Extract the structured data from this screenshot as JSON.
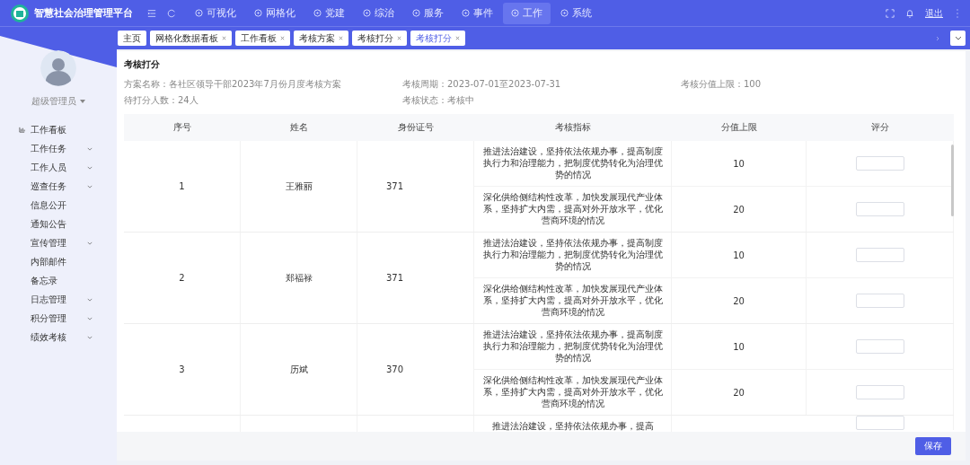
{
  "app": {
    "title": "智慧社会治理管理平台"
  },
  "nav": [
    {
      "label": "可视化",
      "selected": false
    },
    {
      "label": "网格化",
      "selected": false
    },
    {
      "label": "党建",
      "selected": false
    },
    {
      "label": "综治",
      "selected": false
    },
    {
      "label": "服务",
      "selected": false
    },
    {
      "label": "事件",
      "selected": false
    },
    {
      "label": "工作",
      "selected": true
    },
    {
      "label": "系统",
      "selected": false
    }
  ],
  "header_actions": {
    "logout": "退出"
  },
  "tabs": [
    {
      "label": "主页",
      "closable": false,
      "selected": false
    },
    {
      "label": "网格化数据看板",
      "closable": true,
      "selected": false
    },
    {
      "label": "工作看板",
      "closable": true,
      "selected": false
    },
    {
      "label": "考核方案",
      "closable": true,
      "selected": false
    },
    {
      "label": "考核打分",
      "closable": true,
      "selected": false
    },
    {
      "label": "考核打分",
      "closable": true,
      "selected": true
    }
  ],
  "sidebar": {
    "user": "超级管理员",
    "items": [
      {
        "label": "工作看板",
        "expandable": false,
        "icon": true
      },
      {
        "label": "工作任务",
        "expandable": true,
        "icon": false
      },
      {
        "label": "工作人员",
        "expandable": true,
        "icon": false
      },
      {
        "label": "巡查任务",
        "expandable": true,
        "icon": false
      },
      {
        "label": "信息公开",
        "expandable": false,
        "icon": false
      },
      {
        "label": "通知公告",
        "expandable": false,
        "icon": false
      },
      {
        "label": "宣传管理",
        "expandable": true,
        "icon": false
      },
      {
        "label": "内部邮件",
        "expandable": false,
        "icon": false
      },
      {
        "label": "备忘录",
        "expandable": false,
        "icon": false
      },
      {
        "label": "日志管理",
        "expandable": true,
        "icon": false
      },
      {
        "label": "积分管理",
        "expandable": true,
        "icon": false
      },
      {
        "label": "绩效考核",
        "expandable": true,
        "icon": false
      }
    ]
  },
  "panel": {
    "title": "考核打分",
    "info": [
      {
        "label": "方案名称：",
        "value": "各社区领导干部2023年7月份月度考核方案"
      },
      {
        "label": "考核周期：",
        "value": "2023-07-01至2023-07-31"
      },
      {
        "label": "考核分值上限：",
        "value": "100"
      },
      {
        "label": "待打分人数：",
        "value": "24人"
      },
      {
        "label": "考核状态：",
        "value": "考核中"
      }
    ]
  },
  "table": {
    "columns": [
      "序号",
      "姓名",
      "身份证号",
      "考核指标",
      "分值上限",
      "评分"
    ],
    "rows": [
      {
        "index": "1",
        "name": "王雅丽",
        "id": "371",
        "criteria": [
          {
            "text": "推进法治建设，坚持依法依规办事，提高制度执行力和治理能力，把制度优势转化为治理优势的情况",
            "max": "10"
          },
          {
            "text": "深化供给侧结构性改革，加快发展现代产业体系，坚持扩大内需，提高对外开放水平，优化营商环境的情况",
            "max": "20"
          }
        ]
      },
      {
        "index": "2",
        "name": "郑福禄",
        "id": "371",
        "criteria": [
          {
            "text": "推进法治建设，坚持依法依规办事，提高制度执行力和治理能力，把制度优势转化为治理优势的情况",
            "max": "10"
          },
          {
            "text": "深化供给侧结构性改革，加快发展现代产业体系，坚持扩大内需，提高对外开放水平，优化营商环境的情况",
            "max": "20"
          }
        ]
      },
      {
        "index": "3",
        "name": "历斌",
        "id": "370",
        "criteria": [
          {
            "text": "推进法治建设，坚持依法依规办事，提高制度执行力和治理能力，把制度优势转化为治理优势的情况",
            "max": "10"
          },
          {
            "text": "深化供给侧结构性改革，加快发展现代产业体系，坚持扩大内需，提高对外开放水平，优化营商环境的情况",
            "max": "20"
          }
        ]
      },
      {
        "criteria": [
          {
            "text": "推进法治建设，坚持依法依规办事，提高"
          }
        ]
      }
    ]
  },
  "save_button": "保存"
}
